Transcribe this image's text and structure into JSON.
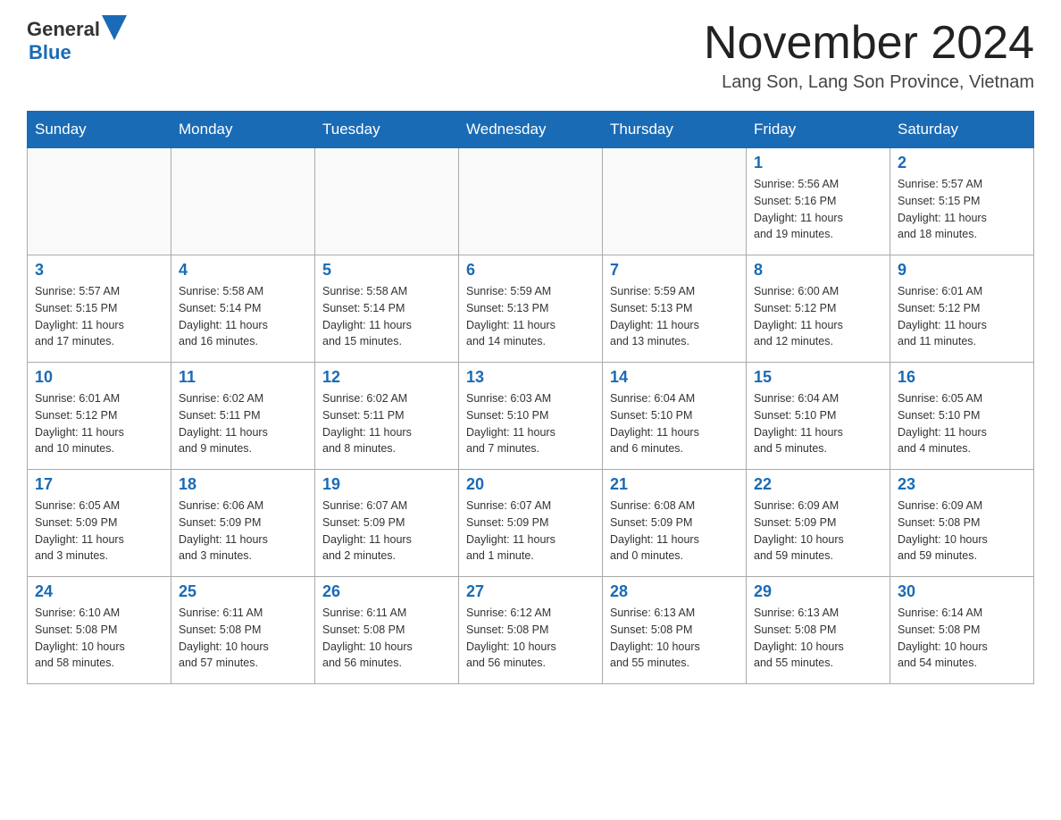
{
  "header": {
    "logo_general": "General",
    "logo_blue": "Blue",
    "month_title": "November 2024",
    "location": "Lang Son, Lang Son Province, Vietnam"
  },
  "weekdays": [
    "Sunday",
    "Monday",
    "Tuesday",
    "Wednesday",
    "Thursday",
    "Friday",
    "Saturday"
  ],
  "weeks": [
    [
      {
        "day": "",
        "info": ""
      },
      {
        "day": "",
        "info": ""
      },
      {
        "day": "",
        "info": ""
      },
      {
        "day": "",
        "info": ""
      },
      {
        "day": "",
        "info": ""
      },
      {
        "day": "1",
        "info": "Sunrise: 5:56 AM\nSunset: 5:16 PM\nDaylight: 11 hours\nand 19 minutes."
      },
      {
        "day": "2",
        "info": "Sunrise: 5:57 AM\nSunset: 5:15 PM\nDaylight: 11 hours\nand 18 minutes."
      }
    ],
    [
      {
        "day": "3",
        "info": "Sunrise: 5:57 AM\nSunset: 5:15 PM\nDaylight: 11 hours\nand 17 minutes."
      },
      {
        "day": "4",
        "info": "Sunrise: 5:58 AM\nSunset: 5:14 PM\nDaylight: 11 hours\nand 16 minutes."
      },
      {
        "day": "5",
        "info": "Sunrise: 5:58 AM\nSunset: 5:14 PM\nDaylight: 11 hours\nand 15 minutes."
      },
      {
        "day": "6",
        "info": "Sunrise: 5:59 AM\nSunset: 5:13 PM\nDaylight: 11 hours\nand 14 minutes."
      },
      {
        "day": "7",
        "info": "Sunrise: 5:59 AM\nSunset: 5:13 PM\nDaylight: 11 hours\nand 13 minutes."
      },
      {
        "day": "8",
        "info": "Sunrise: 6:00 AM\nSunset: 5:12 PM\nDaylight: 11 hours\nand 12 minutes."
      },
      {
        "day": "9",
        "info": "Sunrise: 6:01 AM\nSunset: 5:12 PM\nDaylight: 11 hours\nand 11 minutes."
      }
    ],
    [
      {
        "day": "10",
        "info": "Sunrise: 6:01 AM\nSunset: 5:12 PM\nDaylight: 11 hours\nand 10 minutes."
      },
      {
        "day": "11",
        "info": "Sunrise: 6:02 AM\nSunset: 5:11 PM\nDaylight: 11 hours\nand 9 minutes."
      },
      {
        "day": "12",
        "info": "Sunrise: 6:02 AM\nSunset: 5:11 PM\nDaylight: 11 hours\nand 8 minutes."
      },
      {
        "day": "13",
        "info": "Sunrise: 6:03 AM\nSunset: 5:10 PM\nDaylight: 11 hours\nand 7 minutes."
      },
      {
        "day": "14",
        "info": "Sunrise: 6:04 AM\nSunset: 5:10 PM\nDaylight: 11 hours\nand 6 minutes."
      },
      {
        "day": "15",
        "info": "Sunrise: 6:04 AM\nSunset: 5:10 PM\nDaylight: 11 hours\nand 5 minutes."
      },
      {
        "day": "16",
        "info": "Sunrise: 6:05 AM\nSunset: 5:10 PM\nDaylight: 11 hours\nand 4 minutes."
      }
    ],
    [
      {
        "day": "17",
        "info": "Sunrise: 6:05 AM\nSunset: 5:09 PM\nDaylight: 11 hours\nand 3 minutes."
      },
      {
        "day": "18",
        "info": "Sunrise: 6:06 AM\nSunset: 5:09 PM\nDaylight: 11 hours\nand 3 minutes."
      },
      {
        "day": "19",
        "info": "Sunrise: 6:07 AM\nSunset: 5:09 PM\nDaylight: 11 hours\nand 2 minutes."
      },
      {
        "day": "20",
        "info": "Sunrise: 6:07 AM\nSunset: 5:09 PM\nDaylight: 11 hours\nand 1 minute."
      },
      {
        "day": "21",
        "info": "Sunrise: 6:08 AM\nSunset: 5:09 PM\nDaylight: 11 hours\nand 0 minutes."
      },
      {
        "day": "22",
        "info": "Sunrise: 6:09 AM\nSunset: 5:09 PM\nDaylight: 10 hours\nand 59 minutes."
      },
      {
        "day": "23",
        "info": "Sunrise: 6:09 AM\nSunset: 5:08 PM\nDaylight: 10 hours\nand 59 minutes."
      }
    ],
    [
      {
        "day": "24",
        "info": "Sunrise: 6:10 AM\nSunset: 5:08 PM\nDaylight: 10 hours\nand 58 minutes."
      },
      {
        "day": "25",
        "info": "Sunrise: 6:11 AM\nSunset: 5:08 PM\nDaylight: 10 hours\nand 57 minutes."
      },
      {
        "day": "26",
        "info": "Sunrise: 6:11 AM\nSunset: 5:08 PM\nDaylight: 10 hours\nand 56 minutes."
      },
      {
        "day": "27",
        "info": "Sunrise: 6:12 AM\nSunset: 5:08 PM\nDaylight: 10 hours\nand 56 minutes."
      },
      {
        "day": "28",
        "info": "Sunrise: 6:13 AM\nSunset: 5:08 PM\nDaylight: 10 hours\nand 55 minutes."
      },
      {
        "day": "29",
        "info": "Sunrise: 6:13 AM\nSunset: 5:08 PM\nDaylight: 10 hours\nand 55 minutes."
      },
      {
        "day": "30",
        "info": "Sunrise: 6:14 AM\nSunset: 5:08 PM\nDaylight: 10 hours\nand 54 minutes."
      }
    ]
  ]
}
